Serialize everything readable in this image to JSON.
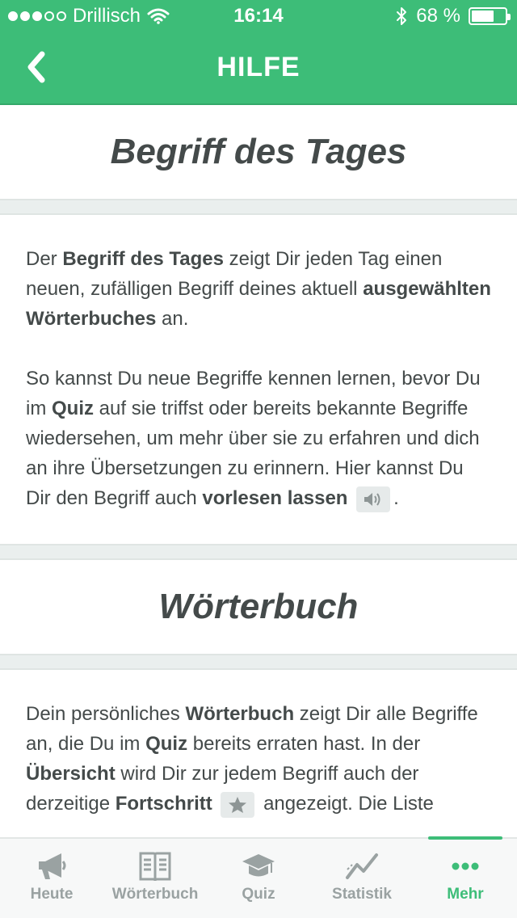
{
  "status": {
    "carrier": "Drillisch",
    "time": "16:14",
    "battery": "68 %",
    "battery_level": 0.68,
    "signal_bars_filled": 3,
    "signal_bars_total": 5
  },
  "nav": {
    "back_icon": "chevron-left-icon",
    "title": "HILFE"
  },
  "sections": [
    {
      "title": "Begriff des Tages",
      "p1": {
        "t1": "Der ",
        "b1": "Begriff des Tages",
        "t2": " zeigt Dir jeden Tag einen neuen, zufälligen Begriff deines aktuell ",
        "b2": "ausgewählten Wörterbuches",
        "t3": " an."
      },
      "p2": {
        "t1": "So kannst Du neue Begriffe kennen lernen, bevor Du im ",
        "b1": "Quiz",
        "t2": " auf sie triffst oder bereits bekannte Begriffe wiedersehen, um mehr über sie zu erfahren und dich an ihre Übersetzungen zu erinnern. Hier kannst Du Dir den Begriff auch ",
        "b2": "vorlesen lassen",
        "icon": "speaker-icon",
        "t3": "."
      }
    },
    {
      "title": "Wörterbuch",
      "p1": {
        "t1": "Dein persönliches ",
        "b1": "Wörterbuch",
        "t2": " zeigt Dir alle Begriffe an, die Du im ",
        "b2": "Quiz",
        "t3": " bereits erraten hast. In der ",
        "b3": "Übersicht",
        "t4": " wird Dir zur jedem Begriff auch der derzeitige ",
        "b4": "Fortschritt",
        "icon": "star-icon",
        "t5": " angezeigt. Die Liste"
      }
    }
  ],
  "tabbar": {
    "items": [
      {
        "label": "Heute",
        "icon": "megaphone-icon"
      },
      {
        "label": "Wörterbuch",
        "icon": "book-icon"
      },
      {
        "label": "Quiz",
        "icon": "graduation-cap-icon"
      },
      {
        "label": "Statistik",
        "icon": "trend-line-icon"
      },
      {
        "label": "Mehr",
        "icon": "more-dots-icon"
      }
    ],
    "active": "Mehr"
  },
  "colors": {
    "brand_green": "#3dbd78",
    "text": "#444a4a",
    "tab_inactive": "#9aa2a2"
  }
}
